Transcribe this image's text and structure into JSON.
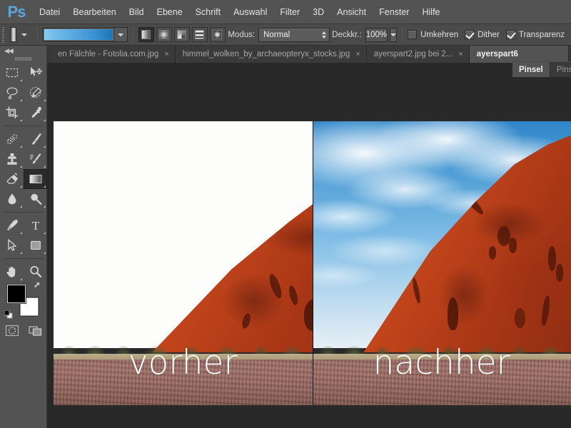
{
  "app": {
    "logo": "Ps",
    "title": "Adobe Photoshop"
  },
  "menubar": {
    "items": [
      {
        "label": "Datei"
      },
      {
        "label": "Bearbeiten"
      },
      {
        "label": "Bild"
      },
      {
        "label": "Ebene"
      },
      {
        "label": "Schrift"
      },
      {
        "label": "Auswahl"
      },
      {
        "label": "Filter"
      },
      {
        "label": "3D"
      },
      {
        "label": "Ansicht"
      },
      {
        "label": "Fenster"
      },
      {
        "label": "Hilfe"
      }
    ]
  },
  "options_bar": {
    "tool": "gradient-tool",
    "tool_preset_icon": "gradient-preset-swatch",
    "gradient_preview": {
      "name": "gradient-swatch",
      "from_color": "#8ecbf0",
      "to_color": "#1a74b8"
    },
    "gradient_types": [
      {
        "name": "linear-gradient-button",
        "selected": true
      },
      {
        "name": "radial-gradient-button",
        "selected": false
      },
      {
        "name": "angle-gradient-button",
        "selected": false
      },
      {
        "name": "reflected-gradient-button",
        "selected": false
      },
      {
        "name": "diamond-gradient-button",
        "selected": false
      }
    ],
    "mode_label": "Modus:",
    "mode_value": "Normal",
    "opacity_label": "Deckkr.:",
    "opacity_value": "100%",
    "checkboxes": [
      {
        "label": "Umkehren",
        "checked": false
      },
      {
        "label": "Dither",
        "checked": true
      },
      {
        "label": "Transparenz",
        "checked": true
      }
    ]
  },
  "tabs": {
    "items": [
      {
        "label": "en Fälchle - Fotolia.com.jpg",
        "active": false,
        "close": "×"
      },
      {
        "label": "himmel_wolken_by_archaeopteryx_stocks.jpg",
        "active": false,
        "close": "×"
      },
      {
        "label": "ayerspart2.jpg bei 2...",
        "active": false,
        "close": "×"
      },
      {
        "label": "ayerspart6",
        "active": true,
        "close": ""
      }
    ]
  },
  "toolbar": {
    "collapse_label": "◀◀",
    "tools": [
      {
        "name": "marquee-tool",
        "selected": false,
        "has_more": true
      },
      {
        "name": "move-tool",
        "selected": false,
        "has_more": false
      },
      {
        "name": "lasso-tool",
        "selected": false,
        "has_more": true
      },
      {
        "name": "quick-selection-tool",
        "selected": false,
        "has_more": true
      },
      {
        "name": "crop-tool",
        "selected": false,
        "has_more": true
      },
      {
        "name": "eyedropper-tool",
        "selected": false,
        "has_more": true
      },
      {
        "name": "spot-healing-brush-tool",
        "selected": false,
        "has_more": true
      },
      {
        "name": "brush-tool",
        "selected": false,
        "has_more": true
      },
      {
        "name": "clone-stamp-tool",
        "selected": false,
        "has_more": true
      },
      {
        "name": "history-brush-tool",
        "selected": false,
        "has_more": true
      },
      {
        "name": "eraser-tool",
        "selected": false,
        "has_more": true
      },
      {
        "name": "gradient-tool",
        "selected": true,
        "has_more": true
      },
      {
        "name": "blur-tool",
        "selected": false,
        "has_more": true
      },
      {
        "name": "dodge-tool",
        "selected": false,
        "has_more": true
      },
      {
        "name": "pen-tool",
        "selected": false,
        "has_more": true
      },
      {
        "name": "type-tool",
        "selected": false,
        "has_more": true
      },
      {
        "name": "path-selection-tool",
        "selected": false,
        "has_more": true
      },
      {
        "name": "rectangle-tool",
        "selected": false,
        "has_more": true
      },
      {
        "name": "hand-tool",
        "selected": false,
        "has_more": true
      },
      {
        "name": "zoom-tool",
        "selected": false,
        "has_more": false
      }
    ],
    "foreground_color": "#000000",
    "background_color": "#ffffff",
    "quick_mask": "quick-mask-button",
    "screen_mode": "screen-mode-button"
  },
  "panels": {
    "tabs": [
      {
        "label": "Pinsel",
        "active": true
      },
      {
        "label": "Pinselvo",
        "active": false
      }
    ]
  },
  "canvas": {
    "comparison": [
      {
        "name": "before-image",
        "caption": "vorher",
        "sky": "blown-out-white"
      },
      {
        "name": "after-image",
        "caption": "nachher",
        "sky": "blue-sky-with-clouds"
      }
    ],
    "subject": "uluru-ayers-rock"
  }
}
